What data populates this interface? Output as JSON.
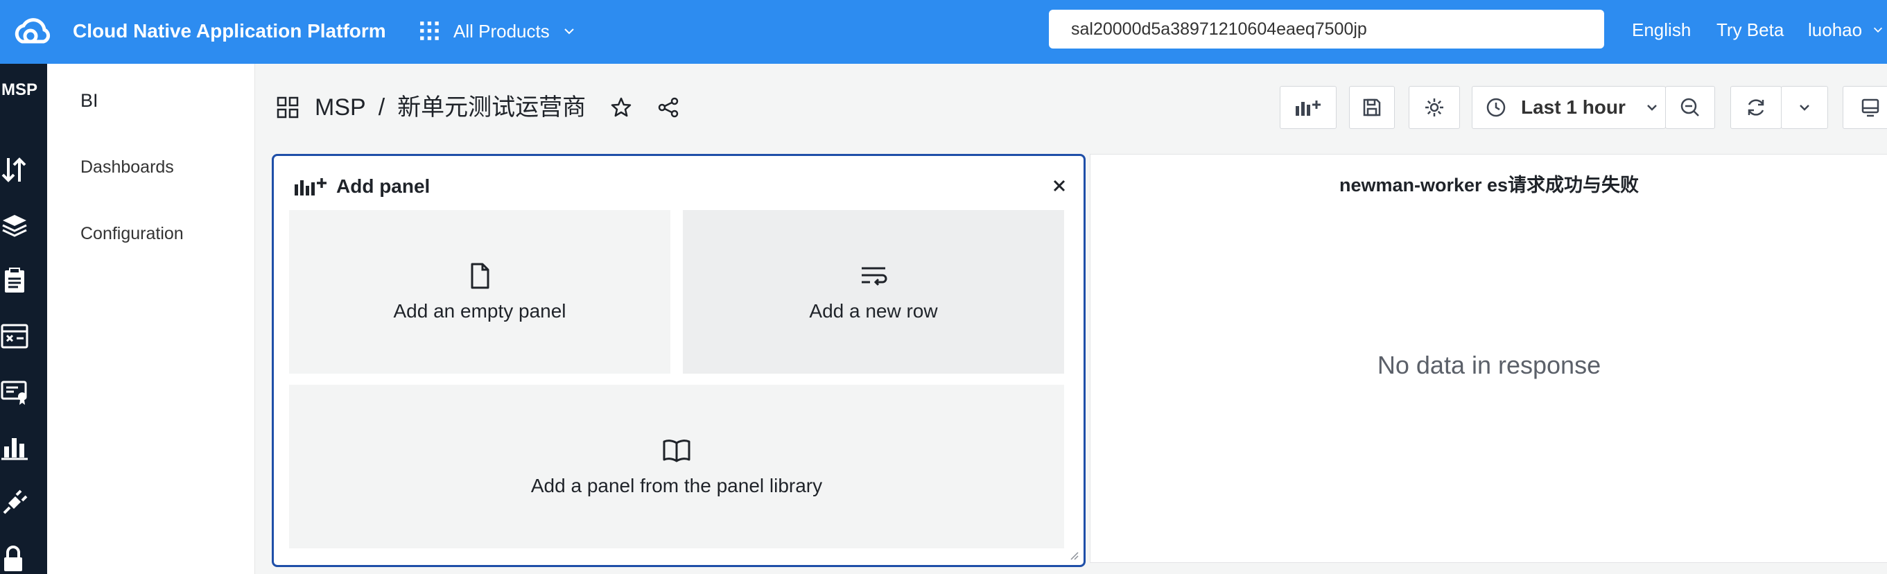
{
  "topbar": {
    "title": "Cloud Native Application Platform",
    "products_label": "All Products",
    "search_value": "sal20000d5a38971210604eaeq7500jp",
    "language": "English",
    "try_beta": "Try Beta",
    "user": "luohao",
    "bg_color": "#2d8cf0"
  },
  "rail": {
    "title": "MSP",
    "icons": [
      "traffic-icon",
      "layers-icon",
      "clipboard-icon",
      "topology-icon",
      "certificate-icon",
      "bar-chart-icon",
      "plug-icon",
      "lock-icon"
    ]
  },
  "subnav": {
    "title": "BI",
    "items": [
      {
        "label": "Dashboards"
      },
      {
        "label": "Configuration"
      }
    ]
  },
  "breadcrumb": {
    "root": "MSP",
    "separator": "/",
    "dashboard": "新单元测试运营商"
  },
  "toolbar": {
    "time_range": "Last 1 hour"
  },
  "add_panel": {
    "title": "Add panel",
    "options": [
      {
        "label": "Add an empty panel",
        "icon": "file-icon"
      },
      {
        "label": "Add a new row",
        "icon": "wrap-lines-icon"
      },
      {
        "label": "Add a panel from the panel library",
        "icon": "book-icon"
      }
    ],
    "border_color": "#1f4fa8"
  },
  "graph_panel": {
    "title": "newman-worker es请求成功与失败",
    "message": "No data in response"
  }
}
